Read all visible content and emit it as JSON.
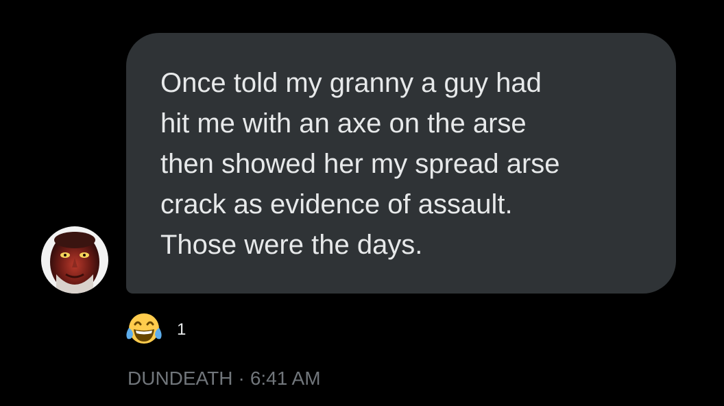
{
  "message": {
    "text": "Once told my granny a guy had\nhit me with an axe on the arse\nthen showed her my spread arse\ncrack as evidence of assault.\nThose were the days."
  },
  "reaction": {
    "icon": "laughing-tears-emoji-icon",
    "count": "1"
  },
  "meta": {
    "sender": "DUNDEATH",
    "separator": "·",
    "time": "6:41 AM"
  },
  "colors": {
    "background": "#000000",
    "bubble": "#2f3336",
    "text": "#e7e9ea",
    "meta": "#71767b"
  }
}
